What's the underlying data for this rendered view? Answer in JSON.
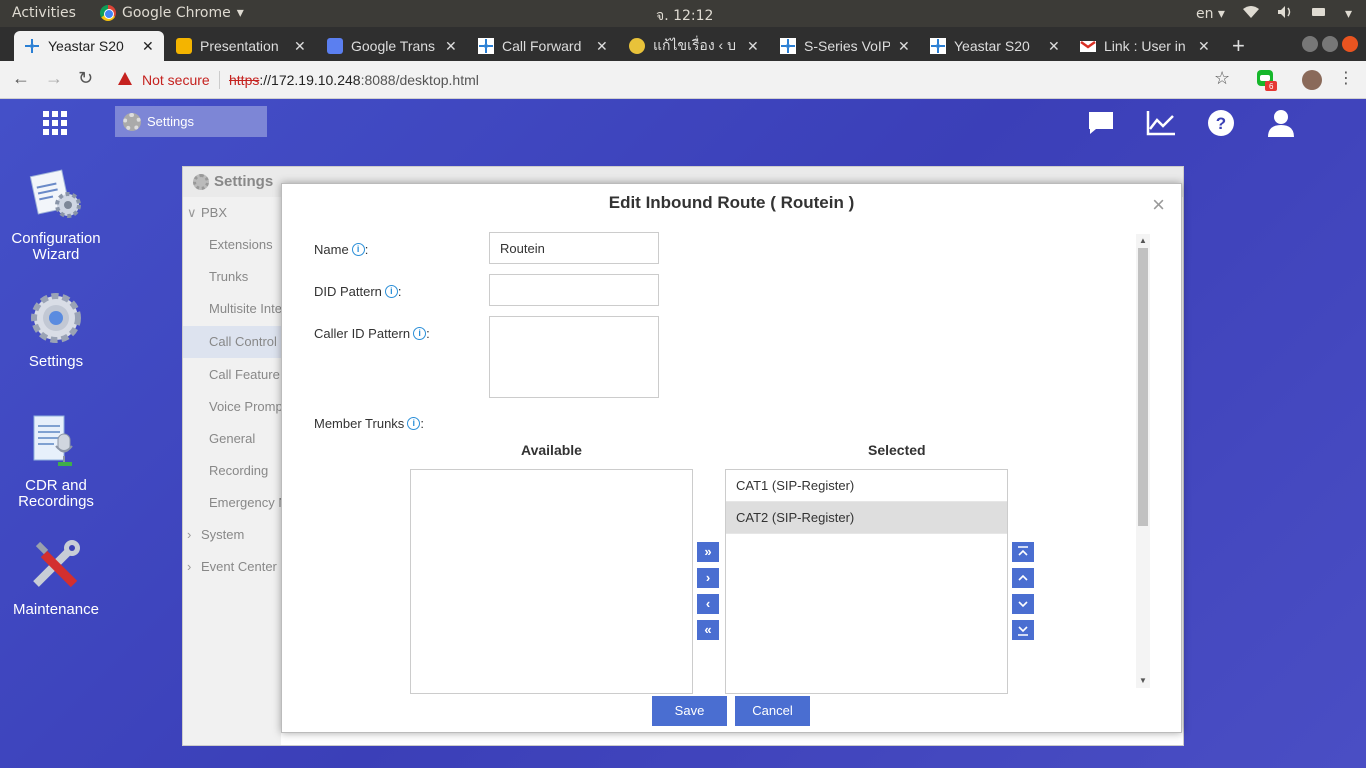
{
  "system_bar": {
    "activities": "Activities",
    "app_name": "Google Chrome",
    "clock": "จ. 12:12",
    "language": "en"
  },
  "tabs": [
    {
      "title": "Yeastar S20",
      "icon": "yeastar-icon",
      "active": true
    },
    {
      "title": "Presentation",
      "icon": "slides-icon"
    },
    {
      "title": "Google Trans",
      "icon": "google-translate-icon"
    },
    {
      "title": "Call Forward",
      "icon": "yeastar-icon"
    },
    {
      "title": "แก้ไขเรื่อง ‹ บ",
      "icon": "forum-icon"
    },
    {
      "title": "S-Series VoIP",
      "icon": "yeastar-icon"
    },
    {
      "title": "Yeastar S20",
      "icon": "yeastar-icon"
    },
    {
      "title": "Link : User in",
      "icon": "gmail-icon"
    }
  ],
  "address_bar": {
    "security": "Not secure",
    "scheme": "https",
    "host": "://172.19.10.248",
    "path": ":8088/desktop.html",
    "extension_badge": "6"
  },
  "desktop": {
    "taskbar_item": "Settings",
    "icons": [
      {
        "label_1": "Configuration",
        "label_2": "Wizard"
      },
      {
        "label_1": "Settings",
        "label_2": ""
      },
      {
        "label_1": "CDR and",
        "label_2": "Recordings"
      },
      {
        "label_1": "Maintenance",
        "label_2": ""
      }
    ]
  },
  "settings_window": {
    "title": "Settings",
    "menu": [
      {
        "label": "PBX",
        "type": "top",
        "expanded": true
      },
      {
        "label": "Extensions",
        "type": "sub"
      },
      {
        "label": "Trunks",
        "type": "sub"
      },
      {
        "label": "Multisite Inte",
        "type": "sub"
      },
      {
        "label": "Call Control",
        "type": "sub",
        "selected": true
      },
      {
        "label": "Call Feature",
        "type": "sub"
      },
      {
        "label": "Voice Promp",
        "type": "sub"
      },
      {
        "label": "General",
        "type": "sub"
      },
      {
        "label": "Recording",
        "type": "sub"
      },
      {
        "label": "Emergency N",
        "type": "sub"
      },
      {
        "label": "System",
        "type": "top"
      },
      {
        "label": "Event Center",
        "type": "top"
      }
    ]
  },
  "dialog": {
    "title": "Edit Inbound Route ( Routein )",
    "name_label": "Name",
    "name_value": "Routein",
    "did_label": "DID Pattern",
    "did_value": "",
    "callerid_label": "Caller ID Pattern",
    "callerid_value": "",
    "trunks_label": "Member Trunks",
    "available_label": "Available",
    "selected_label": "Selected",
    "available_items": [],
    "selected_items": [
      "CAT1 (SIP-Register)",
      "CAT2 (SIP-Register)"
    ],
    "selected_highlight": "CAT2 (SIP-Register)",
    "save_label": "Save",
    "cancel_label": "Cancel",
    "accent_color": "#4a6ed1"
  }
}
